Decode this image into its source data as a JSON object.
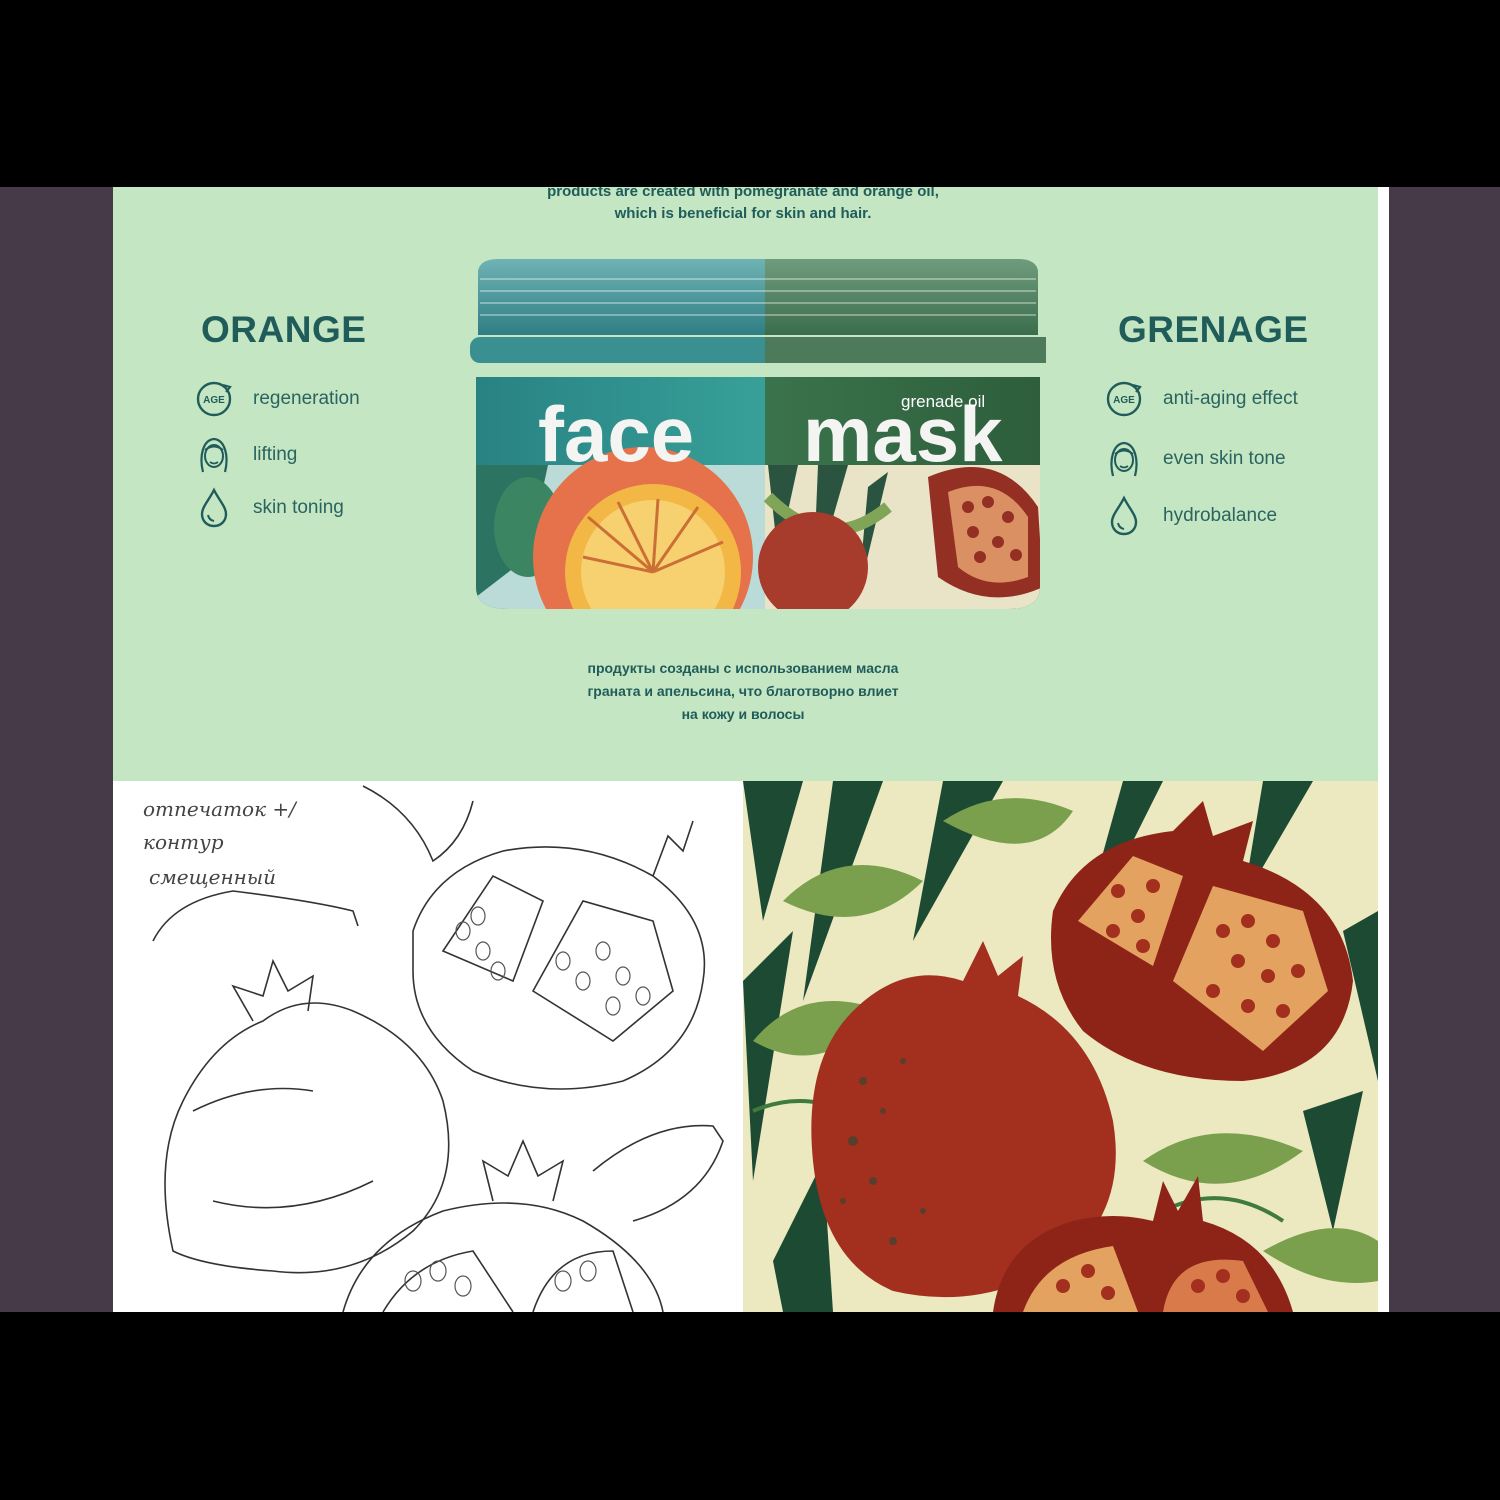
{
  "hero": {
    "intro_en_line1": "products are created with pomegranate and orange oil,",
    "intro_en_line2": "which is beneficial for skin and hair.",
    "intro_ru_line1": "продукты созданы с использованием масла",
    "intro_ru_line2": "граната и апельсина, что благотворно влиет",
    "intro_ru_line3": "на кожу и волосы"
  },
  "orange": {
    "title": "ORANGE",
    "features": [
      {
        "icon": "age-icon",
        "label": "regeneration"
      },
      {
        "icon": "face-icon",
        "label": "lifting"
      },
      {
        "icon": "drop-icon",
        "label": "skin toning"
      }
    ]
  },
  "grenage": {
    "title": "GRENAGE",
    "features": [
      {
        "icon": "age-icon",
        "label": "anti-aging effect"
      },
      {
        "icon": "face-icon",
        "label": "even skin tone"
      },
      {
        "icon": "drop-icon",
        "label": "hydrobalance"
      }
    ]
  },
  "jar": {
    "word_left": "face",
    "word_right": "mask",
    "subtitle": "grenade oil"
  },
  "sketch": {
    "note_line1": "отпечаток +/",
    "note_line2": "контур",
    "note_line3": "смещенный"
  },
  "icon_labels": {
    "age": "AGE"
  },
  "colors": {
    "hero_bg": "#c5e6c3",
    "text_teal": "#1f5c5a",
    "frame": "#463a48",
    "pomegranate_red": "#a3301f",
    "leaf_green": "#7aa04d"
  }
}
